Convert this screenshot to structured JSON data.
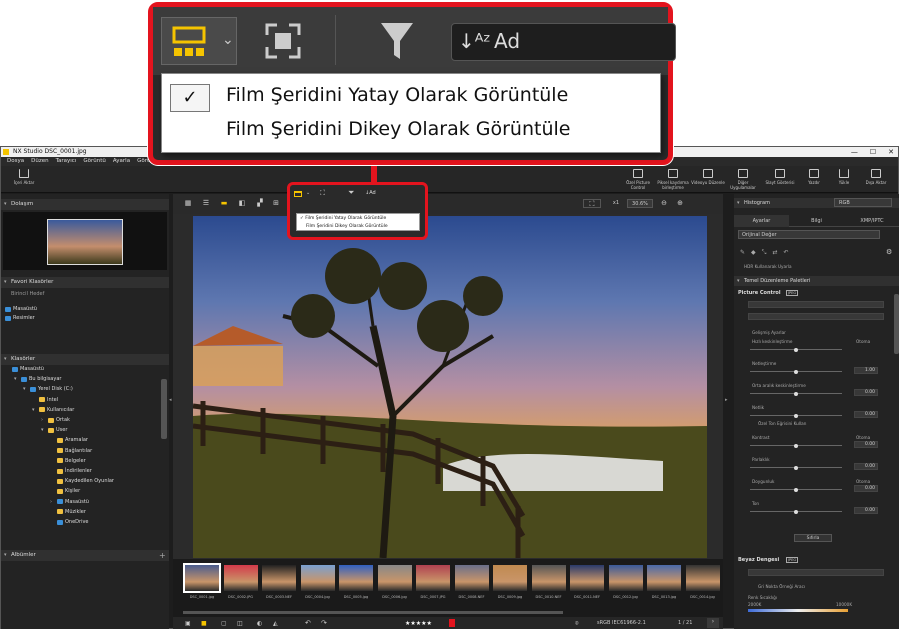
{
  "window": {
    "title": "NX Studio    DSC_0001.jpg",
    "controls": [
      "—",
      "☐",
      "✕"
    ]
  },
  "menubar": [
    "Dosya",
    "Düzen",
    "Tarayıcı",
    "Görüntü",
    "Ayarla",
    "Görüntü"
  ],
  "toolbar": {
    "import": "İçeri Aktar",
    "right_items": [
      "Özel Picture Control",
      "Piksel kaydırma birleştirme",
      "Videoyu Düzenle",
      "Diğer Uygulamalar",
      "Slayt Gösterisi",
      "Yazdır",
      "Yükle",
      "Dışa Aktar"
    ]
  },
  "left": {
    "navigator_title": "Dolaşım",
    "favorites_title": "Favori Klasörler",
    "favorites_sub": "Birincil Hedef",
    "favorites": [
      "Masaüstü",
      "Resimler"
    ],
    "folders_title": "Klasörler",
    "folders": [
      {
        "label": "Masaüstü",
        "indent": 0,
        "arrow": ""
      },
      {
        "label": "Bu bilgisayar",
        "indent": 1,
        "arrow": "▾"
      },
      {
        "label": "Yerel Disk (C:)",
        "indent": 2,
        "arrow": "▾"
      },
      {
        "label": "Intel",
        "indent": 3,
        "arrow": ""
      },
      {
        "label": "Kullanıcılar",
        "indent": 3,
        "arrow": "▾"
      },
      {
        "label": "Ortak",
        "indent": 4,
        "arrow": "›"
      },
      {
        "label": "User",
        "indent": 4,
        "arrow": "▾"
      },
      {
        "label": "Aramalar",
        "indent": 5,
        "arrow": ""
      },
      {
        "label": "Bağlantılar",
        "indent": 5,
        "arrow": ""
      },
      {
        "label": "Belgeler",
        "indent": 5,
        "arrow": ""
      },
      {
        "label": "İndirilenler",
        "indent": 5,
        "arrow": ""
      },
      {
        "label": "Kaydedilen Oyunlar",
        "indent": 5,
        "arrow": ""
      },
      {
        "label": "Kişiler",
        "indent": 5,
        "arrow": ""
      },
      {
        "label": "Masaüstü",
        "indent": 5,
        "arrow": "›"
      },
      {
        "label": "Müzikler",
        "indent": 5,
        "arrow": ""
      },
      {
        "label": "OneDrive",
        "indent": 5,
        "arrow": ""
      }
    ],
    "albums_title": "Albümler"
  },
  "center": {
    "zoom_fit": "x1",
    "zoom_value": "30.6%",
    "sort_label": "Ad",
    "menu_items": [
      {
        "label": "Film Şeridini Yatay Olarak Görüntüle",
        "checked": true
      },
      {
        "label": "Film Şeridini Dikey Olarak Görüntüle",
        "checked": false
      }
    ],
    "thumbnails": [
      "DSC_0001.jpg",
      "DSC_0002.JPG",
      "DSC_0003.NEF",
      "DSC_0004.jpg",
      "DSC_0005.jpg",
      "DSC_0006.jpg",
      "DSC_0007.JPG",
      "DSC_0008.NEF",
      "DSC_0009.jpg",
      "DSC_0010.NEF",
      "DSC_0011.NEF",
      "DSC_0012.jpg",
      "DSC_0013.jpg",
      "DSC_0014.jpg"
    ],
    "status_profile": "sRGB IEC61966-2.1",
    "page_indicator": "1 / 21"
  },
  "right": {
    "histogram_title": "Histogram",
    "histogram_mode": "RGB",
    "tabs": [
      "Ayarlar",
      "Bilgi",
      "XMP/IPTC"
    ],
    "preset": "Orijinal Değer",
    "hdr_label": "HDR Kullanarak Uyarla",
    "palette_title": "Temel Düzenleme Paletleri",
    "picture_control_title": "Picture Control",
    "picture_control_badge": "JPEG",
    "detail_title": "Gelişmiş Ayarlar",
    "sliders": [
      {
        "label": "Hızlı keskinleştirme",
        "value": "",
        "auto": "Otoma"
      },
      {
        "label": "Netleştirme",
        "value": "1.00",
        "auto": ""
      },
      {
        "label": "Orta aralık keskinleştirme",
        "value": "0.00",
        "auto": ""
      },
      {
        "label": "Netlik",
        "value": "0.00",
        "auto": ""
      },
      {
        "label": "Kontrast",
        "value": "0.00",
        "auto": "Otoma"
      },
      {
        "label": "Parlaklık",
        "value": "0.00",
        "auto": ""
      },
      {
        "label": "Doygunluk",
        "value": "0.00",
        "auto": "Otoma"
      },
      {
        "label": "Ton",
        "value": "0.00",
        "auto": ""
      }
    ],
    "custom_curve_label": "Özel Ton Eğrisini Kullan",
    "reset_button": "Sıfırla",
    "wb_title": "Beyaz Dengesi",
    "wb_badge": "JPEG",
    "wb_tool": "Gri Nokta Örneği Aracı",
    "wb_temp_label": "Renk Sıcaklığı",
    "wb_range": [
      "2000K",
      "10000K"
    ]
  },
  "colors": {
    "accent": "#e3141e",
    "active_icon": "#f5c400",
    "panel": "#232323"
  }
}
